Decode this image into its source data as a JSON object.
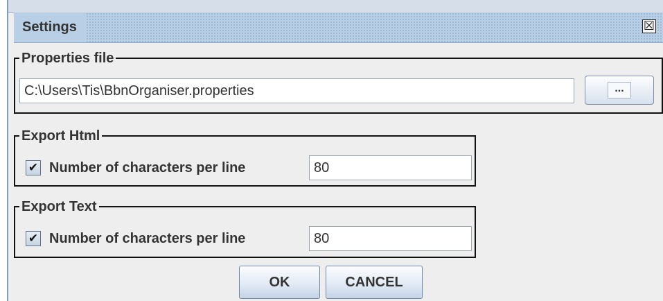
{
  "window": {
    "title": "Settings",
    "close_glyph": "☒",
    "close_icon": "close-icon"
  },
  "properties_group": {
    "title": "Properties file",
    "path_value": "C:\\Users\\Tis\\BbnOrganiser.properties",
    "browse_label": "..."
  },
  "export_html_group": {
    "title": "Export Html",
    "checked": true,
    "checkbox_glyph": "✔",
    "checkbox_label": "Number of characters per line",
    "chars_value": "80"
  },
  "export_text_group": {
    "title": "Export Text",
    "checked": true,
    "checkbox_glyph": "✔",
    "checkbox_label": "Number of characters per line",
    "chars_value": "80"
  },
  "buttons": {
    "ok_label": "OK",
    "cancel_label": "CANCEL"
  }
}
